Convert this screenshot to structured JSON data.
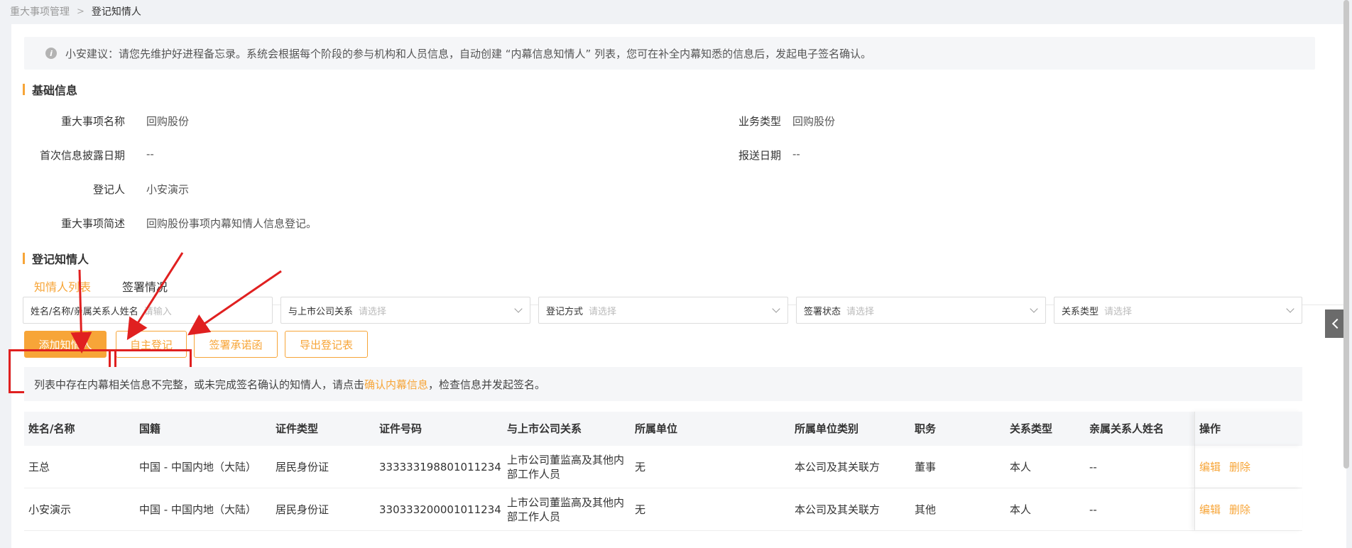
{
  "breadcrumb": {
    "parent": "重大事项管理",
    "current": "登记知情人"
  },
  "tip": {
    "icon": "info-icon",
    "text": "小安建议：请您先维护好进程备忘录。系统会根据每个阶段的参与机构和人员信息，自动创建 “内幕信息知情人” 列表，您可在补全内幕知悉的信息后，发起电子签名确认。"
  },
  "basic": {
    "title": "基础信息",
    "name_label": "重大事项名称",
    "name_value": "回购股份",
    "type_label": "业务类型",
    "type_value": "回购股份",
    "date_label": "首次信息披露日期",
    "date_value": "--",
    "report_label": "报送日期",
    "report_value": "--",
    "registrant_label": "登记人",
    "registrant_value": "小安演示",
    "desc_label": "重大事项简述",
    "desc_value": "回购股份事项内幕知情人信息登记。"
  },
  "register": {
    "title": "登记知情人"
  },
  "tabs": [
    {
      "label": "知情人列表",
      "active": true
    },
    {
      "label": "签署情况",
      "active": false
    }
  ],
  "filters": [
    {
      "label": "姓名/名称/亲属关系人姓名",
      "placeholder": "请输入"
    },
    {
      "label": "与上市公司关系",
      "placeholder": "请选择"
    },
    {
      "label": "登记方式",
      "placeholder": "请选择"
    },
    {
      "label": "签署状态",
      "placeholder": "请选择"
    },
    {
      "label": "关系类型",
      "placeholder": "请选择"
    }
  ],
  "buttons": {
    "add": "添加知情人",
    "self": "自主登记",
    "promise": "签署承诺函",
    "export": "导出登记表"
  },
  "notice": {
    "before": "列表中存在内幕相关信息不完整，或未完成签名确认的知情人，请点击",
    "link": "确认内幕信息",
    "after": "，检查信息并发起签名。"
  },
  "table": {
    "headers": [
      "姓名/名称",
      "国籍",
      "证件类型",
      "证件号码",
      "与上市公司关系",
      "所属单位",
      "所属单位类别",
      "职务",
      "关系类型",
      "亲属关系人姓名",
      "操作"
    ],
    "rows": [
      {
        "name": "王总",
        "nationality": "中国 - 中国内地（大陆）",
        "id_type": "居民身份证",
        "id_no": "333333198801011234",
        "relation": "上市公司董监高及其他内部工作人员",
        "unit": "无",
        "unit_type": "本公司及其关联方",
        "position": "董事",
        "rel_type": "本人",
        "kin": "--",
        "edit": "编辑",
        "delete": "删除"
      },
      {
        "name": "小安演示",
        "nationality": "中国 - 中国内地（大陆）",
        "id_type": "居民身份证",
        "id_no": "330333200001011234",
        "relation": "上市公司董监高及其他内部工作人员",
        "unit": "无",
        "unit_type": "本公司及其关联方",
        "position": "其他",
        "rel_type": "本人",
        "kin": "--",
        "edit": "编辑",
        "delete": "删除"
      }
    ]
  },
  "colors": {
    "accent": "#f7a538",
    "annotation": "#e02020"
  }
}
